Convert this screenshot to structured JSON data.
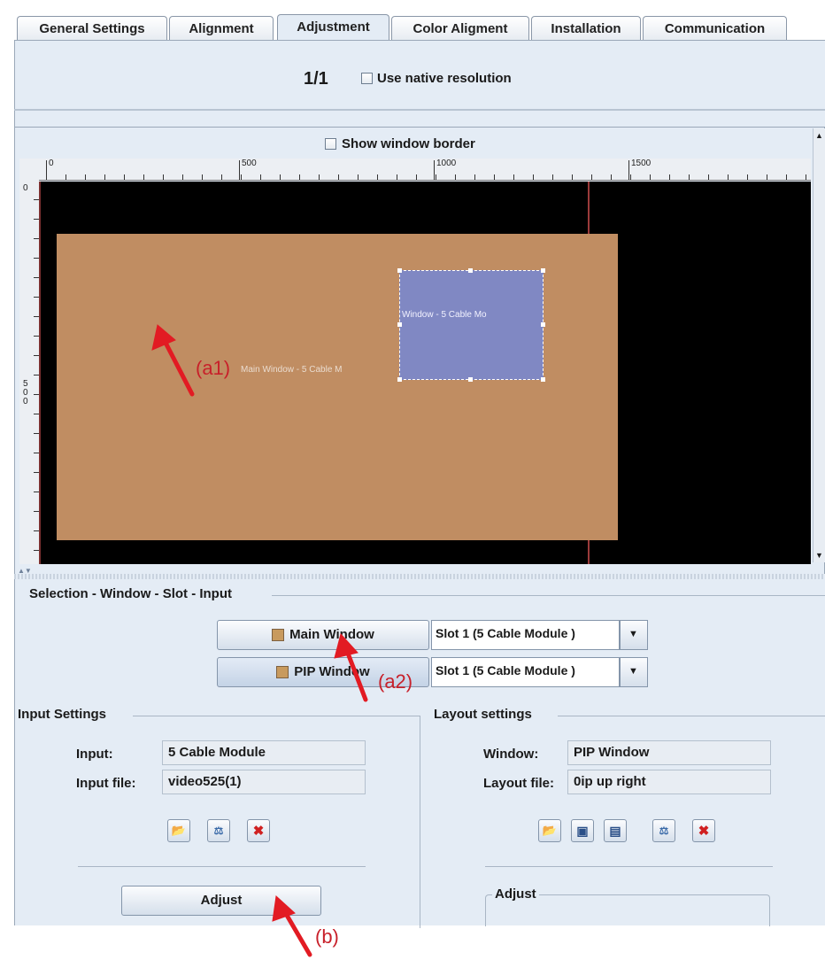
{
  "tabs": [
    "General Settings",
    "Alignment",
    "Adjustment",
    "Color Aligment",
    "Installation",
    "Communication"
  ],
  "active_tab": "Adjustment",
  "page_indicator": "1/1",
  "use_native_resolution": "Use native resolution",
  "show_window_border": "Show window border",
  "ruler_top_labels": [
    "0",
    "500",
    "1000",
    "1500"
  ],
  "ruler_left_labels": [
    "0",
    "5",
    "0",
    "0"
  ],
  "canvas": {
    "main_window_label": "Main Window - 5 Cable M",
    "pip_window_label": "Window - 5 Cable Mo",
    "main_color": "#c08d62",
    "pip_color": "#8088c3"
  },
  "selection": {
    "title": "Selection - Window - Slot - Input",
    "main_button": "Main Window",
    "pip_button": "PIP Window",
    "slot_main": "Slot 1 (5 Cable Module )",
    "slot_pip": "Slot 1 (5 Cable Module )"
  },
  "input_settings": {
    "title": "Input Settings",
    "input_label": "Input:",
    "input_value": "5 Cable Module",
    "file_label": "Input file:",
    "file_value": "video525(1)",
    "adjust_button": "Adjust"
  },
  "layout_settings": {
    "title": "Layout settings",
    "window_label": "Window:",
    "window_value": "PIP Window",
    "file_label": "Layout file:",
    "file_value": "0ip up right",
    "adjust_group": "Adjust"
  },
  "annotations": {
    "a1": "(a1)",
    "a2": "(a2)",
    "b": "(b)"
  }
}
